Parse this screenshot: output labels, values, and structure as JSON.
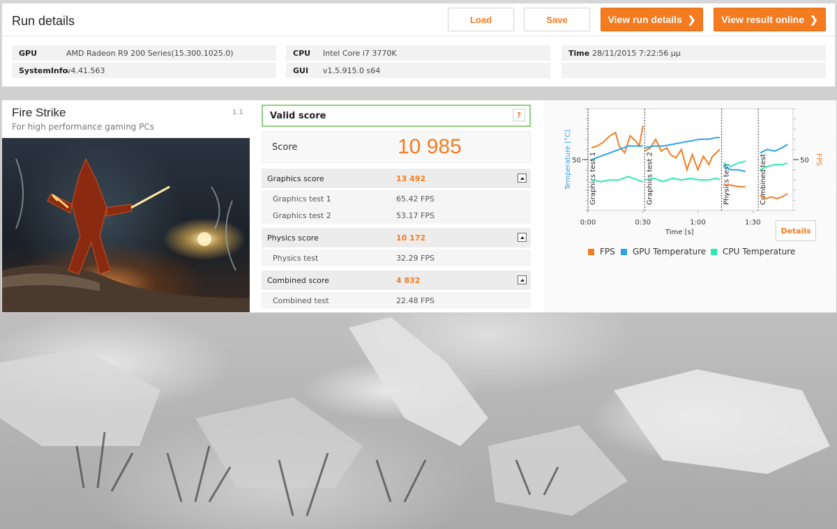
{
  "header": {
    "title": "Run details",
    "load_label": "Load",
    "save_label": "Save",
    "view_run_details_label": "View run details",
    "view_result_online_label": "View result online"
  },
  "system": {
    "gpu_key": "GPU",
    "gpu_value": "AMD Radeon R9 200 Series(15.300.1025.0)",
    "systeminfo_key": "SystemInfo",
    "systeminfo_value": "v4.41.563",
    "cpu_key": "CPU",
    "cpu_value": "Intel Core i7 3770K",
    "gui_key": "GUI",
    "gui_value": "v1.5.915.0 s64",
    "time_key": "Time",
    "time_value": "28/11/2015 7:22:56 μμ"
  },
  "benchmark": {
    "title": "Fire Strike",
    "subtitle": "For high performance gaming PCs",
    "version": "1.1"
  },
  "result": {
    "valid_label": "Valid score",
    "help_label": "?",
    "score_label": "Score",
    "score_value": "10 985",
    "graphics_score_label": "Graphics score",
    "graphics_score_value": "13 492",
    "graphics_test1_label": "Graphics test 1",
    "graphics_test1_value": "65.42 FPS",
    "graphics_test2_label": "Graphics test 2",
    "graphics_test2_value": "53.17 FPS",
    "physics_score_label": "Physics score",
    "physics_score_value": "10 172",
    "physics_test_label": "Physics test",
    "physics_test_value": "32.29 FPS",
    "combined_score_label": "Combined score",
    "combined_score_value": "4 832",
    "combined_test_label": "Combined test",
    "combined_test_value": "22.48 FPS"
  },
  "chart_data": {
    "type": "line",
    "xlabel": "Time [s]",
    "ylabel_left": "Temperature [°C]",
    "ylabel_right": "FPS",
    "x_ticks": [
      "0:00",
      "0:30",
      "1:00",
      "1:30"
    ],
    "y_tick_left": "50",
    "y_tick_right": "50",
    "xlim": [
      0,
      100
    ],
    "ylim_left": [
      20,
      80
    ],
    "ylim_right": [
      20,
      80
    ],
    "sections": [
      {
        "name": "Graphics test 1",
        "start": 0
      },
      {
        "name": "Graphics test 2",
        "start": 31
      },
      {
        "name": "Physics test",
        "start": 73
      },
      {
        "name": "Combined test",
        "start": 93
      }
    ],
    "details_label": "Details",
    "series": [
      {
        "name": "FPS",
        "color": "#f47b20",
        "segments": [
          [
            [
              2,
              57
            ],
            [
              5,
              58
            ],
            [
              8,
              60
            ],
            [
              12,
              64
            ],
            [
              15,
              66
            ],
            [
              17,
              58
            ],
            [
              20,
              54
            ],
            [
              23,
              64
            ],
            [
              26,
              61
            ],
            [
              28,
              58
            ],
            [
              30,
              70
            ]
          ],
          [
            [
              31,
              55
            ],
            [
              34,
              57
            ],
            [
              37,
              62
            ],
            [
              40,
              55
            ],
            [
              43,
              57
            ],
            [
              45,
              53
            ],
            [
              48,
              51
            ],
            [
              51,
              56
            ],
            [
              54,
              44
            ],
            [
              57,
              53
            ],
            [
              60,
              44
            ],
            [
              63,
              52
            ],
            [
              66,
              47
            ],
            [
              68,
              52
            ],
            [
              70,
              54
            ],
            [
              72,
              56
            ]
          ],
          [
            [
              74,
              35
            ],
            [
              78,
              35
            ],
            [
              82,
              34
            ],
            [
              86,
              34
            ]
          ],
          [
            [
              94,
              29
            ],
            [
              97,
              27
            ],
            [
              100,
              28
            ],
            [
              103,
              27
            ],
            [
              106,
              28
            ],
            [
              109,
              30
            ]
          ]
        ]
      },
      {
        "name": "GPU Temperature",
        "color": "#2aa2e8",
        "segments": [
          [
            [
              2,
              50
            ],
            [
              7,
              52
            ],
            [
              12,
              54
            ],
            [
              17,
              56
            ],
            [
              22,
              58
            ],
            [
              27,
              58
            ],
            [
              30,
              58
            ]
          ],
          [
            [
              31,
              57
            ],
            [
              36,
              58
            ],
            [
              41,
              58
            ],
            [
              46,
              59
            ],
            [
              51,
              60
            ],
            [
              56,
              61
            ],
            [
              61,
              62
            ],
            [
              66,
              62
            ],
            [
              70,
              63
            ],
            [
              72,
              63
            ]
          ],
          [
            [
              74,
              46
            ],
            [
              78,
              44
            ],
            [
              82,
              44
            ],
            [
              86,
              43
            ]
          ],
          [
            [
              94,
              54
            ],
            [
              98,
              56
            ],
            [
              102,
              55
            ],
            [
              106,
              57
            ],
            [
              109,
              59
            ]
          ]
        ]
      },
      {
        "name": "CPU Temperature",
        "color": "#2de8b4",
        "segments": [
          [
            [
              2,
              38
            ],
            [
              7,
              37
            ],
            [
              12,
              38
            ],
            [
              17,
              38
            ],
            [
              22,
              40
            ],
            [
              27,
              38
            ],
            [
              30,
              37
            ]
          ],
          [
            [
              31,
              38
            ],
            [
              36,
              39
            ],
            [
              41,
              37
            ],
            [
              46,
              39
            ],
            [
              51,
              38
            ],
            [
              56,
              39
            ],
            [
              61,
              38
            ],
            [
              66,
              38
            ],
            [
              70,
              39
            ],
            [
              72,
              38
            ]
          ],
          [
            [
              74,
              48
            ],
            [
              78,
              46
            ],
            [
              82,
              48
            ],
            [
              86,
              49
            ]
          ],
          [
            [
              94,
              44
            ],
            [
              98,
              46
            ],
            [
              102,
              47
            ],
            [
              106,
              47
            ],
            [
              109,
              48
            ]
          ]
        ]
      }
    ]
  }
}
